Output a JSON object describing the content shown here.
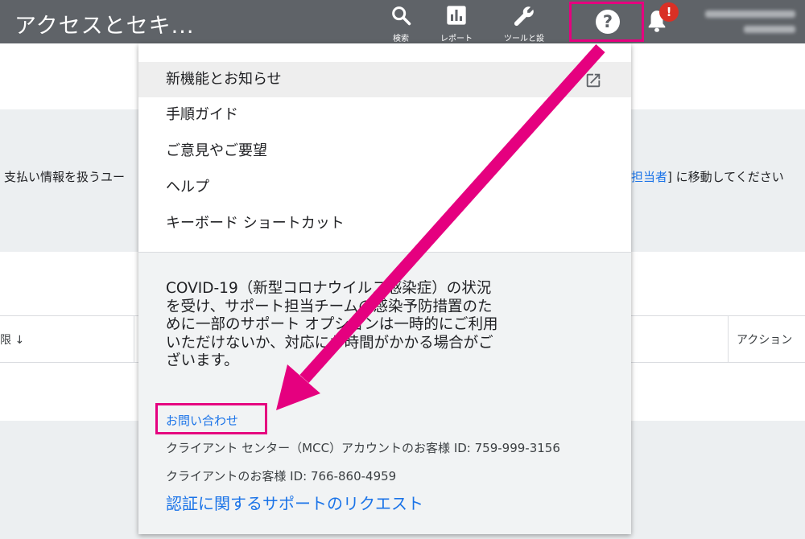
{
  "header": {
    "title": "アクセスとセキ...",
    "search_label": "検索",
    "reports_label": "レポート",
    "tools_label": "ツールと設",
    "help_icon": "?",
    "alert_badge": "!"
  },
  "background": {
    "info_text_left": "支払い情報を扱うユー",
    "info_link": "担当者",
    "info_text_right": "] に移動してください",
    "col_left": "限 ↓",
    "col_right": "アクション"
  },
  "help_menu": {
    "items": [
      {
        "label": "新機能とお知らせ"
      },
      {
        "label": "手順ガイド"
      },
      {
        "label": "ご意見やご要望"
      },
      {
        "label": "ヘルプ"
      },
      {
        "label": "キーボード ショートカット"
      }
    ],
    "notice": "COVID-19（新型コロナウイルス感染症）の状況を受け、サポート担当チームの感染予防措置のために一部のサポート オプションは一時的にご利用いただけないか、対応にお時間がかかる場合がございます。",
    "contact_label": "お問い合わせ",
    "mcc_customer": "クライアント センター（MCC）アカウントのお客様 ID: 759-999-3156",
    "customer": "クライアントのお客様 ID: 766-860-4959",
    "auth_support": "認証に関するサポートのリクエスト"
  },
  "colors": {
    "header_bg": "#5f6368",
    "highlight": "#e5007f",
    "link": "#1a73e8",
    "alert": "#d93025"
  }
}
